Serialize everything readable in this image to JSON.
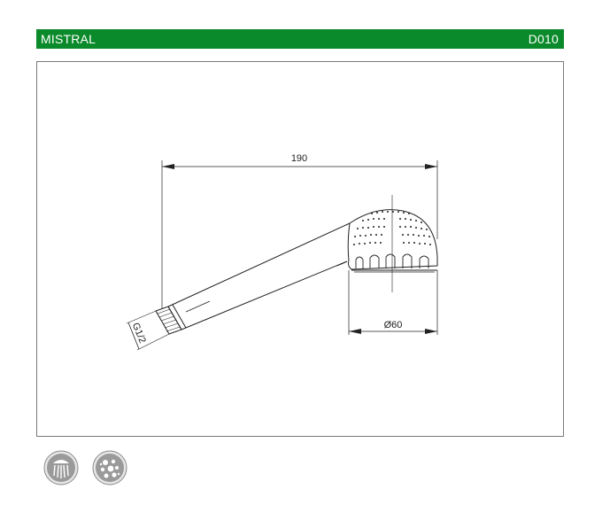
{
  "header": {
    "title": "MISTRAL",
    "code": "D010"
  },
  "drawing": {
    "dim_length": "190",
    "dim_diameter": "Ø60",
    "dim_thread": "G1/2"
  },
  "icons": [
    {
      "name": "shower-spray-icon"
    },
    {
      "name": "massage-jets-icon"
    }
  ],
  "colors": {
    "header_bg": "#0a8a2a",
    "header_text": "#ffffff",
    "line": "#222222",
    "icon_fill": "#9a9a9a"
  }
}
